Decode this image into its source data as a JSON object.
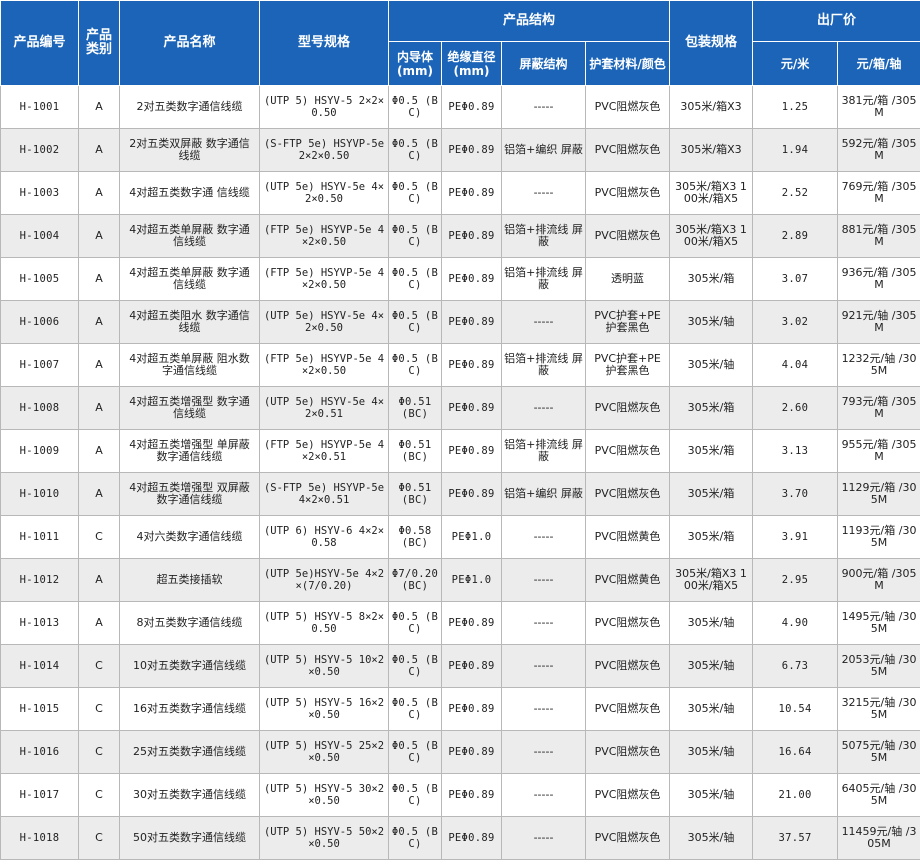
{
  "headers": {
    "code": "产品编号",
    "category": "产品类别",
    "name": "产品名称",
    "model": "型号规格",
    "structure": "产品结构",
    "inner": "内导体(mm)",
    "insulation": "绝缘直径(mm)",
    "shield": "屏蔽结构",
    "sheath": "护套材料/颜色",
    "package": "包装规格",
    "price": "出厂价",
    "unit_m": "元/米",
    "unit_box": "元/箱/轴"
  },
  "rows": [
    {
      "code": "H-1001",
      "cat": "A",
      "name": "2对五类数字通信线缆",
      "model": "(UTP 5) HSYV-5 2×2×0.50",
      "inner": "Φ0.5 (BC)",
      "ins": "PEΦ0.89",
      "shield": "-----",
      "sheath": "PVC阻燃灰色",
      "pack": "305米/箱X3",
      "pm": "1.25",
      "pb": "381元/箱 /305M"
    },
    {
      "code": "H-1002",
      "cat": "A",
      "name": "2对五类双屏蔽 数字通信线缆",
      "model": "(S-FTP 5e) HSYVP-5e 2×2×0.50",
      "inner": "Φ0.5 (BC)",
      "ins": "PEΦ0.89",
      "shield": "铝箔+编织 屏蔽",
      "sheath": "PVC阻燃灰色",
      "pack": "305米/箱X3",
      "pm": "1.94",
      "pb": "592元/箱 /305M"
    },
    {
      "code": "H-1003",
      "cat": "A",
      "name": "4对超五类数字通 信线缆",
      "model": "(UTP 5e) HSYV-5e 4×2×0.50",
      "inner": "Φ0.5 (BC)",
      "ins": "PEΦ0.89",
      "shield": "-----",
      "sheath": "PVC阻燃灰色",
      "pack": "305米/箱X3 100米/箱X5",
      "pm": "2.52",
      "pb": "769元/箱 /305M"
    },
    {
      "code": "H-1004",
      "cat": "A",
      "name": "4对超五类单屏蔽 数字通信线缆",
      "model": "(FTP 5e) HSYVP-5e 4×2×0.50",
      "inner": "Φ0.5 (BC)",
      "ins": "PEΦ0.89",
      "shield": "铝箔+排流线 屏蔽",
      "sheath": "PVC阻燃灰色",
      "pack": "305米/箱X3 100米/箱X5",
      "pm": "2.89",
      "pb": "881元/箱 /305M"
    },
    {
      "code": "H-1005",
      "cat": "A",
      "name": "4对超五类单屏蔽 数字通信线缆",
      "model": "(FTP 5e) HSYVP-5e 4×2×0.50",
      "inner": "Φ0.5 (BC)",
      "ins": "PEΦ0.89",
      "shield": "铝箔+排流线 屏蔽",
      "sheath": "透明蓝",
      "pack": "305米/箱",
      "pm": "3.07",
      "pb": "936元/箱 /305M"
    },
    {
      "code": "H-1006",
      "cat": "A",
      "name": "4对超五类阻水 数字通信线缆",
      "model": "(UTP 5e) HSYV-5e 4×2×0.50",
      "inner": "Φ0.5 (BC)",
      "ins": "PEΦ0.89",
      "shield": "-----",
      "sheath": "PVC护套+PE 护套黑色",
      "pack": "305米/轴",
      "pm": "3.02",
      "pb": "921元/轴 /305M"
    },
    {
      "code": "H-1007",
      "cat": "A",
      "name": "4对超五类单屏蔽 阻水数字通信线缆",
      "model": "(FTP 5e) HSYVP-5e 4×2×0.50",
      "inner": "Φ0.5 (BC)",
      "ins": "PEΦ0.89",
      "shield": "铝箔+排流线 屏蔽",
      "sheath": "PVC护套+PE 护套黑色",
      "pack": "305米/轴",
      "pm": "4.04",
      "pb": "1232元/轴 /305M"
    },
    {
      "code": "H-1008",
      "cat": "A",
      "name": "4对超五类增强型 数字通信线缆",
      "model": "(UTP 5e) HSYV-5e 4×2×0.51",
      "inner": "Φ0.51 (BC)",
      "ins": "PEΦ0.89",
      "shield": "-----",
      "sheath": "PVC阻燃灰色",
      "pack": "305米/箱",
      "pm": "2.60",
      "pb": "793元/箱 /305M"
    },
    {
      "code": "H-1009",
      "cat": "A",
      "name": "4对超五类增强型 单屏蔽数字通信线缆",
      "model": "(FTP 5e) HSYVP-5e 4×2×0.51",
      "inner": "Φ0.51 (BC)",
      "ins": "PEΦ0.89",
      "shield": "铝箔+排流线 屏蔽",
      "sheath": "PVC阻燃灰色",
      "pack": "305米/箱",
      "pm": "3.13",
      "pb": "955元/箱 /305M"
    },
    {
      "code": "H-1010",
      "cat": "A",
      "name": "4对超五类增强型 双屏蔽数字通信线缆",
      "model": "(S-FTP 5e) HSYVP-5e 4×2×0.51",
      "inner": "Φ0.51 (BC)",
      "ins": "PEΦ0.89",
      "shield": "铝箔+编织 屏蔽",
      "sheath": "PVC阻燃灰色",
      "pack": "305米/箱",
      "pm": "3.70",
      "pb": "1129元/箱 /305M"
    },
    {
      "code": "H-1011",
      "cat": "C",
      "name": "4对六类数字通信线缆",
      "model": "(UTP 6) HSYV-6 4×2×0.58",
      "inner": "Φ0.58 (BC)",
      "ins": "PEΦ1.0",
      "shield": "-----",
      "sheath": "PVC阻燃黄色",
      "pack": "305米/箱",
      "pm": "3.91",
      "pb": "1193元/箱 /305M"
    },
    {
      "code": "H-1012",
      "cat": "A",
      "name": "超五类接插软",
      "model": "(UTP 5e)HSYV-5e 4×2×(7/0.20)",
      "inner": "Φ7/0.20 (BC)",
      "ins": "PEΦ1.0",
      "shield": "-----",
      "sheath": "PVC阻燃黄色",
      "pack": "305米/箱X3 100米/箱X5",
      "pm": "2.95",
      "pb": "900元/箱 /305M"
    },
    {
      "code": "H-1013",
      "cat": "A",
      "name": "8对五类数字通信线缆",
      "model": "(UTP 5) HSYV-5 8×2×0.50",
      "inner": "Φ0.5 (BC)",
      "ins": "PEΦ0.89",
      "shield": "-----",
      "sheath": "PVC阻燃灰色",
      "pack": "305米/轴",
      "pm": "4.90",
      "pb": "1495元/轴 /305M"
    },
    {
      "code": "H-1014",
      "cat": "C",
      "name": "10对五类数字通信线缆",
      "model": "(UTP 5) HSYV-5 10×2×0.50",
      "inner": "Φ0.5 (BC)",
      "ins": "PEΦ0.89",
      "shield": "-----",
      "sheath": "PVC阻燃灰色",
      "pack": "305米/轴",
      "pm": "6.73",
      "pb": "2053元/轴 /305M"
    },
    {
      "code": "H-1015",
      "cat": "C",
      "name": "16对五类数字通信线缆",
      "model": "(UTP 5) HSYV-5 16×2×0.50",
      "inner": "Φ0.5 (BC)",
      "ins": "PEΦ0.89",
      "shield": "-----",
      "sheath": "PVC阻燃灰色",
      "pack": "305米/轴",
      "pm": "10.54",
      "pb": "3215元/轴 /305M"
    },
    {
      "code": "H-1016",
      "cat": "C",
      "name": "25对五类数字通信线缆",
      "model": "(UTP 5) HSYV-5 25×2×0.50",
      "inner": "Φ0.5 (BC)",
      "ins": "PEΦ0.89",
      "shield": "-----",
      "sheath": "PVC阻燃灰色",
      "pack": "305米/轴",
      "pm": "16.64",
      "pb": "5075元/轴 /305M"
    },
    {
      "code": "H-1017",
      "cat": "C",
      "name": "30对五类数字通信线缆",
      "model": "(UTP 5) HSYV-5 30×2×0.50",
      "inner": "Φ0.5 (BC)",
      "ins": "PEΦ0.89",
      "shield": "-----",
      "sheath": "PVC阻燃灰色",
      "pack": "305米/轴",
      "pm": "21.00",
      "pb": "6405元/轴 /305M"
    },
    {
      "code": "H-1018",
      "cat": "C",
      "name": "50对五类数字通信线缆",
      "model": "(UTP 5) HSYV-5 50×2×0.50",
      "inner": "Φ0.5 (BC)",
      "ins": "PEΦ0.89",
      "shield": "-----",
      "sheath": "PVC阻燃灰色",
      "pack": "305米/轴",
      "pm": "37.57",
      "pb": "11459元/轴 /305M"
    }
  ]
}
